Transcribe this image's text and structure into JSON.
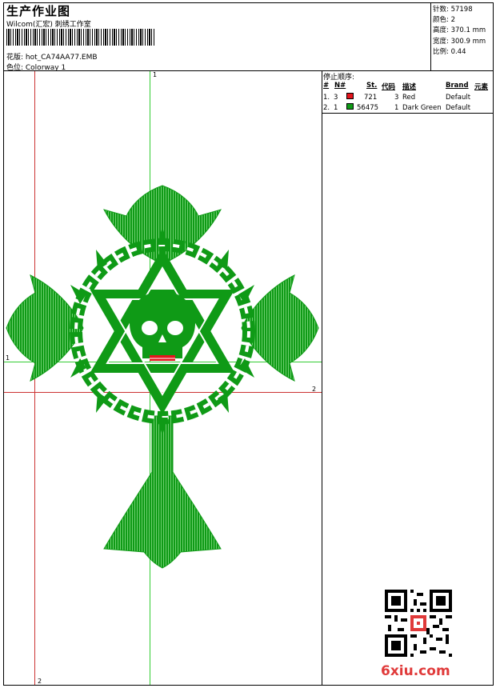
{
  "header": {
    "title": "生产作业图",
    "subtitle": "Wilcom(汇宏) 刺绣工作室",
    "design_label": "花版: hot_CA74AA77.EMB",
    "colorway_label": "色位: Colorway 1"
  },
  "stats": [
    "针数: 57198",
    "颜色: 2",
    "高度: 370.1 mm",
    "宽度: 300.9 mm",
    "比例: 0.44"
  ],
  "stop_sequence": {
    "title": "停止顺序:",
    "columns": [
      "#",
      "N#",
      "St.",
      "代码",
      "描述",
      "Brand",
      "元素"
    ],
    "rows": [
      {
        "idx": "1.",
        "n": "3",
        "stitches": "721",
        "code": "3",
        "desc": "Red",
        "brand": "Default",
        "color": "#e3141c"
      },
      {
        "idx": "2.",
        "n": "1",
        "stitches": "56475",
        "code": "1",
        "desc": "Dark Green",
        "brand": "Default",
        "color": "#0f9a16"
      }
    ]
  },
  "guides": {
    "top_label": "1",
    "left_label": "1",
    "right_label": "2",
    "bottom_label": "2"
  },
  "colors": {
    "design": "#0f9a16",
    "accent": "#e3141c",
    "guide_green": "#33cc33",
    "guide_red": "#cc3333"
  },
  "watermark": "6xiu.com"
}
